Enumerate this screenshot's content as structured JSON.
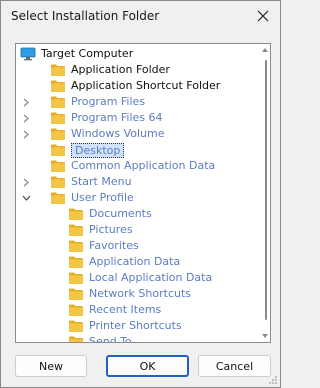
{
  "window": {
    "title": "Select Installation Folder"
  },
  "tree": {
    "items": [
      {
        "label": "Target Computer",
        "level": 0,
        "icon": "computer-icon",
        "expander": "",
        "style": "dark",
        "name": "tree-item-target-computer"
      },
      {
        "label": "Application Folder",
        "level": 1,
        "icon": "folder-icon",
        "expander": "",
        "style": "dark",
        "name": "tree-item-application-folder"
      },
      {
        "label": "Application Shortcut Folder",
        "level": 1,
        "icon": "folder-icon",
        "expander": "",
        "style": "dark",
        "name": "tree-item-application-shortcut-folder"
      },
      {
        "label": "Program Files",
        "level": 1,
        "icon": "folder-icon",
        "expander": "collapsed",
        "style": "blue",
        "name": "tree-item-program-files"
      },
      {
        "label": "Program Files 64",
        "level": 1,
        "icon": "folder-icon",
        "expander": "collapsed",
        "style": "blue",
        "name": "tree-item-program-files-64"
      },
      {
        "label": "Windows Volume",
        "level": 1,
        "icon": "folder-icon",
        "expander": "collapsed",
        "style": "blue",
        "name": "tree-item-windows-volume"
      },
      {
        "label": "Desktop",
        "level": 1,
        "icon": "folder-icon",
        "expander": "",
        "style": "selected",
        "name": "tree-item-desktop"
      },
      {
        "label": "Common Application Data",
        "level": 1,
        "icon": "folder-icon",
        "expander": "",
        "style": "blue",
        "name": "tree-item-common-application-data"
      },
      {
        "label": "Start Menu",
        "level": 1,
        "icon": "folder-icon",
        "expander": "collapsed",
        "style": "blue",
        "name": "tree-item-start-menu"
      },
      {
        "label": "User Profile",
        "level": 1,
        "icon": "folder-icon",
        "expander": "expanded",
        "style": "blue",
        "name": "tree-item-user-profile"
      },
      {
        "label": "Documents",
        "level": 2,
        "icon": "folder-icon",
        "expander": "",
        "style": "blue",
        "name": "tree-item-documents"
      },
      {
        "label": "Pictures",
        "level": 2,
        "icon": "folder-icon",
        "expander": "",
        "style": "blue",
        "name": "tree-item-pictures"
      },
      {
        "label": "Favorites",
        "level": 2,
        "icon": "folder-icon",
        "expander": "",
        "style": "blue",
        "name": "tree-item-favorites"
      },
      {
        "label": "Application Data",
        "level": 2,
        "icon": "folder-icon",
        "expander": "",
        "style": "blue",
        "name": "tree-item-application-data"
      },
      {
        "label": "Local Application Data",
        "level": 2,
        "icon": "folder-icon",
        "expander": "",
        "style": "blue",
        "name": "tree-item-local-application-data"
      },
      {
        "label": "Network Shortcuts",
        "level": 2,
        "icon": "folder-icon",
        "expander": "",
        "style": "blue",
        "name": "tree-item-network-shortcuts"
      },
      {
        "label": "Recent Items",
        "level": 2,
        "icon": "folder-icon",
        "expander": "",
        "style": "blue",
        "name": "tree-item-recent-items"
      },
      {
        "label": "Printer Shortcuts",
        "level": 2,
        "icon": "folder-icon",
        "expander": "",
        "style": "blue",
        "name": "tree-item-printer-shortcuts"
      },
      {
        "label": "Send To",
        "level": 2,
        "icon": "folder-icon",
        "expander": "",
        "style": "blue",
        "name": "tree-item-send-to"
      }
    ]
  },
  "buttons": {
    "new_label": "New",
    "ok_label": "OK",
    "cancel_label": "Cancel"
  },
  "colors": {
    "folder_fill": "#f4c542",
    "folder_tab": "#e5ad23",
    "monitor": "#2f9be0",
    "link_text": "#5c7dc0",
    "ok_border": "#1f63c9"
  }
}
